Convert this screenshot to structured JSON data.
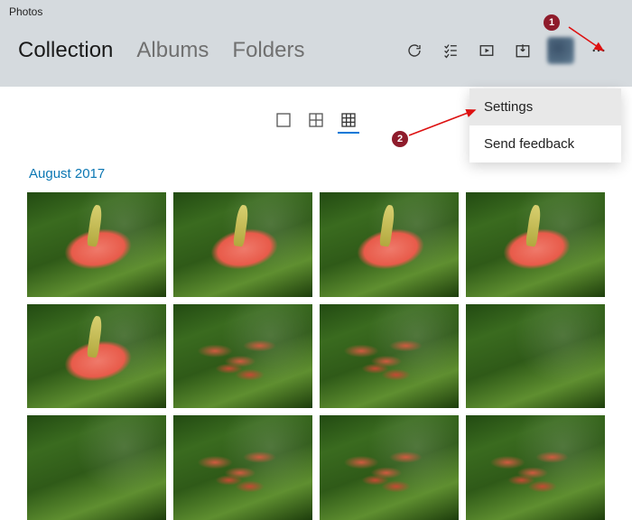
{
  "titlebar": {
    "app_name": "Photos"
  },
  "nav": {
    "tabs": [
      {
        "label": "Collection",
        "active": true
      },
      {
        "label": "Albums",
        "active": false
      },
      {
        "label": "Folders",
        "active": false
      }
    ]
  },
  "toolbar": {
    "refresh": "Refresh",
    "select": "Select",
    "slideshow": "Slideshow",
    "import": "Import",
    "more": "See more"
  },
  "view_modes": {
    "single": "Single",
    "medium": "Medium grid",
    "small": "Small grid"
  },
  "section": {
    "title": "August 2017"
  },
  "dropdown": {
    "settings": "Settings",
    "feedback": "Send feedback"
  },
  "annotations": {
    "badge1": "1",
    "badge2": "2"
  }
}
